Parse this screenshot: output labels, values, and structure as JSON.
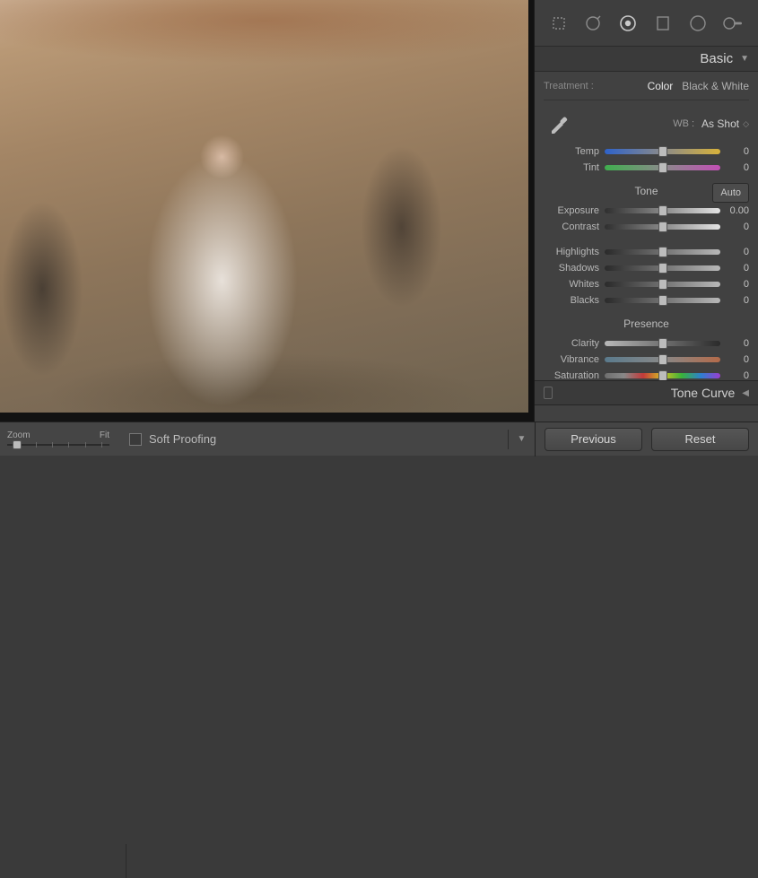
{
  "panel": {
    "title": "Basic"
  },
  "treatment": {
    "label": "Treatment :",
    "color": "Color",
    "bw": "Black & White"
  },
  "wb": {
    "label": "WB :",
    "value": "As Shot"
  },
  "sliders": {
    "temp": {
      "label": "Temp",
      "value": "0"
    },
    "tint": {
      "label": "Tint",
      "value": "0"
    },
    "exposure": {
      "label": "Exposure",
      "value": "0.00"
    },
    "contrast": {
      "label": "Contrast",
      "value": "0"
    },
    "highlights": {
      "label": "Highlights",
      "value": "0"
    },
    "shadows": {
      "label": "Shadows",
      "value": "0"
    },
    "whites": {
      "label": "Whites",
      "value": "0"
    },
    "blacks": {
      "label": "Blacks",
      "value": "0"
    },
    "clarity": {
      "label": "Clarity",
      "value": "0"
    },
    "vibrance": {
      "label": "Vibrance",
      "value": "0"
    },
    "saturation": {
      "label": "Saturation",
      "value": "0"
    }
  },
  "sections": {
    "tone": "Tone",
    "presence": "Presence",
    "auto": "Auto"
  },
  "tonecurve": {
    "title": "Tone Curve"
  },
  "zoom": {
    "label": "Zoom",
    "fit": "Fit"
  },
  "softproof": {
    "label": "Soft Proofing"
  },
  "buttons": {
    "previous": "Previous",
    "reset": "Reset"
  }
}
